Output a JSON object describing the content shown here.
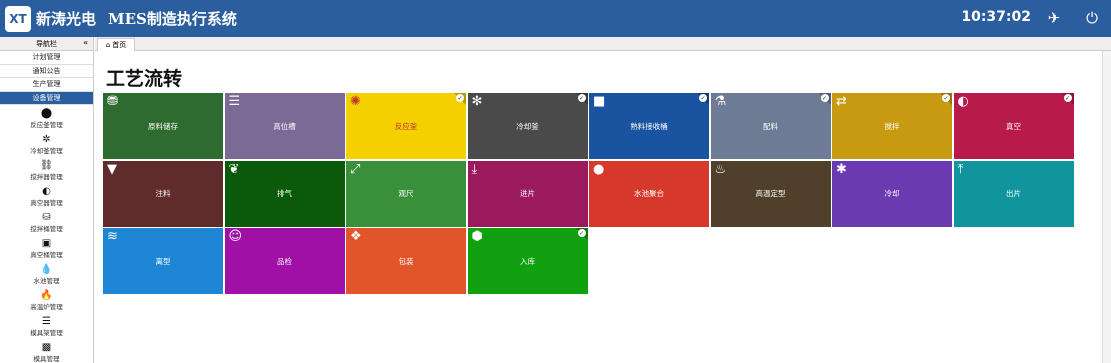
{
  "header": {
    "brand": "新涛光电",
    "system_title": "MES制造执行系统",
    "time": "10:37:02",
    "logo_text": "XT"
  },
  "sidebar": {
    "title": "导航栏",
    "collapse_glyph": "«",
    "categories": [
      {
        "label": "计划管理",
        "active": false
      },
      {
        "label": "通知公告",
        "active": false
      },
      {
        "label": "生产管理",
        "active": false
      },
      {
        "label": "设备管理",
        "active": true
      }
    ],
    "items": [
      {
        "label": "反应釜管理",
        "icon": "pin-icon",
        "glyph": "⬤"
      },
      {
        "label": "冷却釜管理",
        "icon": "snowflake-icon",
        "glyph": "✲"
      },
      {
        "label": "搅拌器管理",
        "icon": "link-icon",
        "glyph": "⛓"
      },
      {
        "label": "真空器管理",
        "icon": "contrast-icon",
        "glyph": "◐"
      },
      {
        "label": "搅拌桶管理",
        "icon": "bucket-icon",
        "glyph": "⛁"
      },
      {
        "label": "真空桶管理",
        "icon": "barrel-icon",
        "glyph": "▣"
      },
      {
        "label": "水池管理",
        "icon": "drop-icon",
        "glyph": "💧"
      },
      {
        "label": "高温炉管理",
        "icon": "fire-icon",
        "glyph": "🔥"
      },
      {
        "label": "模具架管理",
        "icon": "rack-icon",
        "glyph": "☰"
      },
      {
        "label": "模具管理",
        "icon": "instagram-icon",
        "glyph": "▩"
      }
    ]
  },
  "tabs": {
    "home_label": "首页"
  },
  "main": {
    "title": "工艺流转",
    "tiles": [
      {
        "label": "原料储存",
        "color": "#2e6b30",
        "icon": "database-icon",
        "glyph": "⛃",
        "check": false,
        "style": ""
      },
      {
        "label": "高位槽",
        "color": "#7b6a96",
        "icon": "list-icon",
        "glyph": "☰",
        "check": false,
        "style": ""
      },
      {
        "label": "反应釜",
        "color": "#f5d000",
        "icon": "sun-icon",
        "glyph": "✺",
        "check": true,
        "style": "yellow"
      },
      {
        "label": "冷却釜",
        "color": "#4a4a4a",
        "icon": "spinner-icon",
        "glyph": "✻",
        "check": true,
        "style": ""
      },
      {
        "label": "熟料接收桶",
        "color": "#1a54a0",
        "icon": "square-icon",
        "glyph": "■",
        "check": true,
        "style": ""
      },
      {
        "label": "配料",
        "color": "#6d7c94",
        "icon": "flask-icon",
        "glyph": "⚗",
        "check": true,
        "style": ""
      },
      {
        "label": "搅拌",
        "color": "#c89a10",
        "icon": "retweet-icon",
        "glyph": "⇄",
        "check": true,
        "style": ""
      },
      {
        "label": "真空",
        "color": "#b81a4a",
        "icon": "contrast-icon",
        "glyph": "◐",
        "check": true,
        "style": ""
      },
      {
        "label": "注料",
        "color": "#5f2b2b",
        "icon": "filter-icon",
        "glyph": "▼",
        "check": false,
        "style": ""
      },
      {
        "label": "排气",
        "color": "#0a5a0a",
        "icon": "leaf-icon",
        "glyph": "❦",
        "check": false,
        "style": ""
      },
      {
        "label": "观尺",
        "color": "#3a8f3a",
        "icon": "expand-icon",
        "glyph": "⤢",
        "check": false,
        "style": ""
      },
      {
        "label": "进片",
        "color": "#9b1a5e",
        "icon": "download-icon",
        "glyph": "⤓",
        "check": false,
        "style": ""
      },
      {
        "label": "水池聚合",
        "color": "#d7382c",
        "icon": "drop-icon",
        "glyph": "●",
        "check": false,
        "style": ""
      },
      {
        "label": "高温定型",
        "color": "#50402a",
        "icon": "fire-icon",
        "glyph": "♨",
        "check": false,
        "style": ""
      },
      {
        "label": "冷却",
        "color": "#6a3ab0",
        "icon": "asterisk-icon",
        "glyph": "✱",
        "check": false,
        "style": ""
      },
      {
        "label": "出片",
        "color": "#10959e",
        "icon": "upload-icon",
        "glyph": "⤒",
        "check": false,
        "style": ""
      },
      {
        "label": "离型",
        "color": "#1f86d6",
        "icon": "stack-icon",
        "glyph": "≋",
        "check": false,
        "style": ""
      },
      {
        "label": "品检",
        "color": "#a010a6",
        "icon": "inspector-icon",
        "glyph": "☺",
        "check": false,
        "style": ""
      },
      {
        "label": "包装",
        "color": "#e0552a",
        "icon": "dropbox-icon",
        "glyph": "❖",
        "check": false,
        "style": ""
      },
      {
        "label": "入库",
        "color": "#10a010",
        "icon": "cubes-icon",
        "glyph": "⬢",
        "check": true,
        "style": ""
      }
    ]
  }
}
